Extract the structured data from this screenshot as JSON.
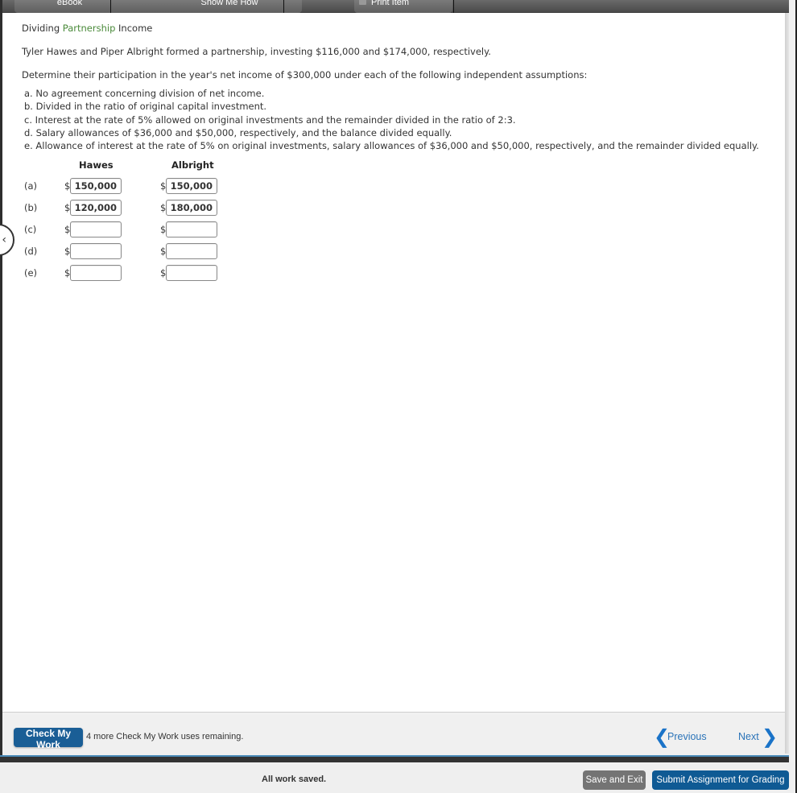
{
  "topbar": {
    "tabs": [
      {
        "label": "eBook"
      },
      {
        "label": "Show Me How"
      },
      {
        "label": "Print Item",
        "icon": "print-icon"
      }
    ]
  },
  "problem": {
    "title_parts": [
      "Dividing ",
      "Partnership",
      " Income"
    ],
    "intro": "Tyler Hawes and Piper Albright formed a partnership, investing $116,000 and $174,000, respectively.",
    "instruction": "Determine their participation in the year's net income of $300,000 under each of the following independent assumptions:",
    "assumptions": [
      "a. No agreement concerning division of net income.",
      "b. Divided in the ratio of original capital investment.",
      "c. Interest at the rate of 5% allowed on original investments and the remainder divided in the ratio of 2:3.",
      "d. Salary allowances of $36,000 and $50,000, respectively, and the balance divided equally.",
      "e. Allowance of interest at the rate of 5% on original investments, salary allowances of $36,000 and $50,000, respectively, and the remainder divided equally."
    ]
  },
  "answer_table": {
    "columns": [
      "Hawes",
      "Albright"
    ],
    "currency": "$",
    "rows": [
      {
        "label": "(a)",
        "hawes": "150,000",
        "albright": "150,000"
      },
      {
        "label": "(b)",
        "hawes": "120,000",
        "albright": "180,000"
      },
      {
        "label": "(c)",
        "hawes": "",
        "albright": ""
      },
      {
        "label": "(d)",
        "hawes": "",
        "albright": ""
      },
      {
        "label": "(e)",
        "hawes": "",
        "albright": ""
      }
    ]
  },
  "bottom": {
    "check_label": "Check My Work",
    "remaining": "4 more Check My Work uses remaining.",
    "previous": "Previous",
    "next": "Next"
  },
  "footer": {
    "status": "All work saved.",
    "save_exit": "Save and Exit",
    "submit": "Submit Assignment for Grading"
  },
  "colors": {
    "accent_blue": "#1a5e96",
    "link_blue": "#2a73b8",
    "title_green": "#4a8a3a"
  }
}
